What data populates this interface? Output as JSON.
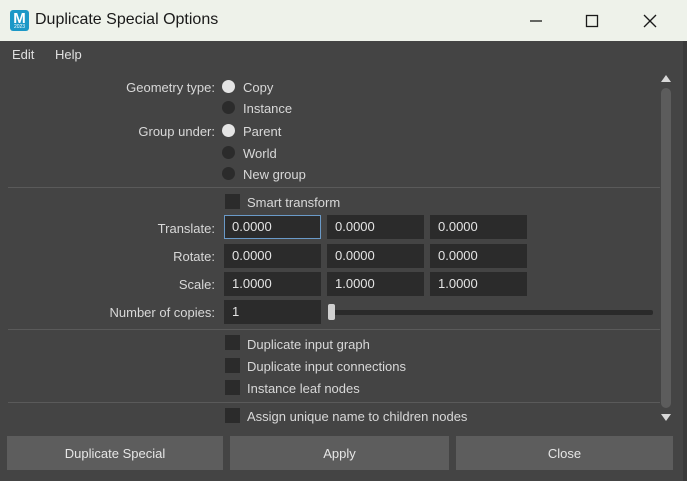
{
  "window": {
    "title": "Duplicate Special Options",
    "icon_letter": "M",
    "icon_sub": "2023"
  },
  "menu": [
    "Edit",
    "Help"
  ],
  "geometry": {
    "label": "Geometry type:",
    "options": [
      {
        "label": "Copy",
        "selected": true
      },
      {
        "label": "Instance",
        "selected": false
      }
    ]
  },
  "group": {
    "label": "Group under:",
    "options": [
      {
        "label": "Parent",
        "selected": true
      },
      {
        "label": "World",
        "selected": false
      },
      {
        "label": "New group",
        "selected": false
      }
    ]
  },
  "smart_transform": {
    "label": "Smart transform",
    "checked": false
  },
  "translate": {
    "label": "Translate:",
    "values": [
      "0.0000",
      "0.0000",
      "0.0000"
    ]
  },
  "rotate": {
    "label": "Rotate:",
    "values": [
      "0.0000",
      "0.0000",
      "0.0000"
    ]
  },
  "scale": {
    "label": "Scale:",
    "values": [
      "1.0000",
      "1.0000",
      "1.0000"
    ]
  },
  "copies": {
    "label": "Number of copies:",
    "value": "1"
  },
  "checkboxes": [
    {
      "label": "Duplicate input graph",
      "checked": false
    },
    {
      "label": "Duplicate input connections",
      "checked": false
    },
    {
      "label": "Instance leaf nodes",
      "checked": false
    }
  ],
  "unique_name": {
    "label": "Assign unique name to children nodes",
    "checked": false
  },
  "buttons": {
    "duplicate": "Duplicate Special",
    "apply": "Apply",
    "close": "Close"
  }
}
